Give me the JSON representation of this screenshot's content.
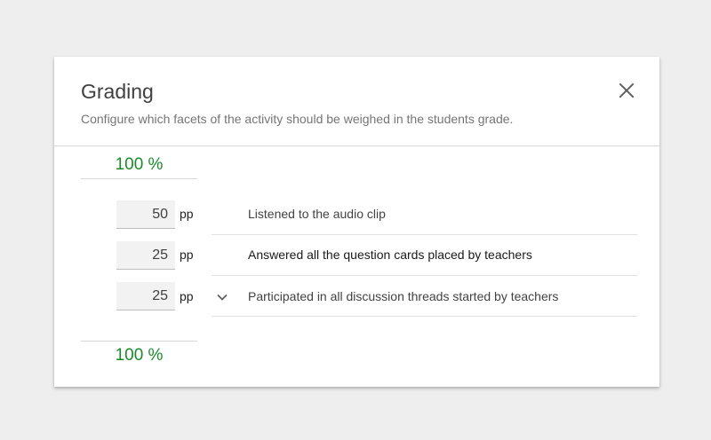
{
  "dialog": {
    "title": "Grading",
    "subtitle": "Configure which facets of the activity should be weighed in the students grade."
  },
  "totals": {
    "top": "100 %",
    "bottom": "100 %"
  },
  "criteria": [
    {
      "points": "50",
      "unit": "pp",
      "label": "Listened to the audio clip",
      "expandable": false
    },
    {
      "points": "25",
      "unit": "pp",
      "label": "Answered all the question cards placed by teachers",
      "expandable": false
    },
    {
      "points": "25",
      "unit": "pp",
      "label": "Participated in all discussion threads started by teachers",
      "expandable": true
    }
  ],
  "icons": {
    "close": "close-icon",
    "expand": "chevron-down-icon"
  },
  "colors": {
    "total_green": "#1b8a2a",
    "background": "#eeeeee",
    "dialog": "#ffffff"
  }
}
